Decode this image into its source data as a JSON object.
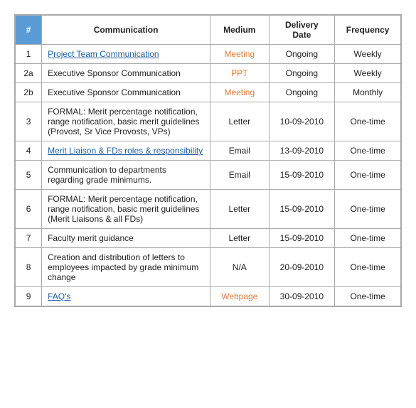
{
  "table": {
    "headers": [
      "#",
      "Communication",
      "Medium",
      "Delivery Date",
      "Frequency"
    ],
    "rows": [
      {
        "num": "1",
        "comm": "Project Team Communication",
        "comm_link": true,
        "medium": "Meeting",
        "medium_class": "medium-meeting",
        "date": "Ongoing",
        "freq": "Weekly"
      },
      {
        "num": "2a",
        "comm": "Executive Sponsor Communication",
        "comm_link": false,
        "medium": "PPT",
        "medium_class": "medium-ppt",
        "date": "Ongoing",
        "freq": "Weekly"
      },
      {
        "num": "2b",
        "comm": "Executive Sponsor Communication",
        "comm_link": false,
        "medium": "Meeting",
        "medium_class": "medium-meeting",
        "date": "Ongoing",
        "freq": "Monthly"
      },
      {
        "num": "3",
        "comm": "FORMAL: Merit percentage notification, range notification, basic merit guidelines (Provost, Sr Vice Provosts, VPs)",
        "comm_link": false,
        "medium": "Letter",
        "medium_class": "medium-letter",
        "date": "10-09-2010",
        "freq": "One-time"
      },
      {
        "num": "4",
        "comm": "Merit Liaison & FDs roles & responsibility",
        "comm_link": true,
        "medium": "Email",
        "medium_class": "medium-email",
        "date": "13-09-2010",
        "freq": "One-time"
      },
      {
        "num": "5",
        "comm": "Communication to departments regarding grade minimums.",
        "comm_link": false,
        "medium": "Email",
        "medium_class": "medium-email",
        "date": "15-09-2010",
        "freq": "One-time"
      },
      {
        "num": "6",
        "comm": "FORMAL: Merit percentage notification, range notification, basic merit guidelines (Merit Liaisons & all FDs)",
        "comm_link": false,
        "medium": "Letter",
        "medium_class": "medium-letter",
        "date": "15-09-2010",
        "freq": "One-time"
      },
      {
        "num": "7",
        "comm": "Faculty merit guidance",
        "comm_link": false,
        "medium": "Letter",
        "medium_class": "medium-letter",
        "date": "15-09-2010",
        "freq": "One-time"
      },
      {
        "num": "8",
        "comm": "Creation and distribution of letters to employees impacted by grade minimum change",
        "comm_link": false,
        "medium": "N/A",
        "medium_class": "medium-na",
        "date": "20-09-2010",
        "freq": "One-time"
      },
      {
        "num": "9",
        "comm": "FAQ's",
        "comm_link": true,
        "medium": "Webpage",
        "medium_class": "medium-webpage",
        "date": "30-09-2010",
        "freq": "One-time"
      }
    ]
  }
}
